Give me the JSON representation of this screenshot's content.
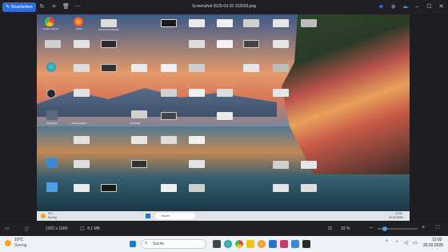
{
  "viewer": {
    "edit_label": "Bearbeiten",
    "title": "Screenshot 2025-03-20 103029.png",
    "toolbar_icons": [
      "rotate-icon",
      "crop-icon",
      "delete-icon",
      "more-icon"
    ],
    "status": {
      "dimensions": "1920 x 1080",
      "size": "4,1 MB",
      "zoom": "33 %"
    }
  },
  "desktop": {
    "icons": [
      {
        "label": "Google Chrome"
      },
      {
        "label": "Firefox"
      },
      {
        "label": "Screenshot 2025-03-20"
      },
      {
        "label": "Papierkorb"
      },
      {
        "label": "Nikola Tesla (1)"
      },
      {
        "label": "HOTTEN"
      }
    ]
  },
  "inner_taskbar": {
    "weather_temp": "9°C",
    "weather_desc": "Sonnig",
    "search": "Suche",
    "time": "12:02",
    "date": "20.03.2025"
  },
  "taskbar": {
    "weather_temp": "10°C",
    "weather_desc": "Sonnig",
    "search_placeholder": "Suche",
    "time": "12:02",
    "date": "20.03.2025",
    "colors": {
      "accent": "#2c6fd6",
      "taskbar_bg": "#eef1f6",
      "viewer_bg": "#1e1e22"
    }
  }
}
